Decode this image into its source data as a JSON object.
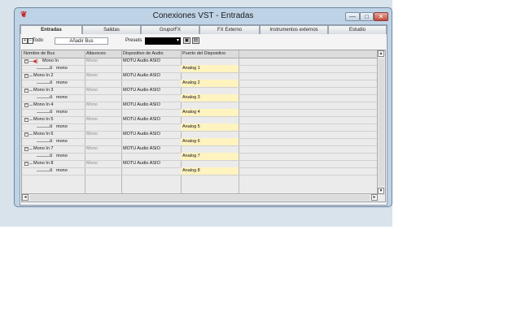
{
  "window": {
    "title": "Conexiones VST - Entradas",
    "buttons": {
      "minimize": "—",
      "maximize": "□",
      "close": "✕"
    }
  },
  "tabs": [
    {
      "label": "Entradas",
      "active": true
    },
    {
      "label": "Salidas",
      "active": false
    },
    {
      "label": "Grupo/FX",
      "active": false
    },
    {
      "label": "FX Externo",
      "active": false
    },
    {
      "label": "Instrumentos externos",
      "active": false
    },
    {
      "label": "Estudio",
      "active": false
    }
  ],
  "toolbar": {
    "todo_label": "Todo",
    "add_bus_label": "Añadir Bus",
    "presets_label": "Presets",
    "presets_value": "▾"
  },
  "grid": {
    "columns": [
      "Nombre de Bus",
      "Altavoces",
      "Dispositivo de Audio",
      "Puerto del Dispositivo"
    ],
    "buses": [
      {
        "name": "Mono In",
        "speakers": "Mono",
        "device": "MOTU Audio ASIO",
        "channel": "mono",
        "port": "Analog 1",
        "speaker_icon": true
      },
      {
        "name": "Mono In 2",
        "speakers": "Mono",
        "device": "MOTU Audio ASIO",
        "channel": "mono",
        "port": "Analog 2"
      },
      {
        "name": "Mono In 3",
        "speakers": "Mono",
        "device": "MOTU Audio ASIO",
        "channel": "mono",
        "port": "Analog 3"
      },
      {
        "name": "Mono In 4",
        "speakers": "Mono",
        "device": "MOTU Audio ASIO",
        "channel": "mono",
        "port": "Analog 4"
      },
      {
        "name": "Mono In 5",
        "speakers": "Mono",
        "device": "MOTU Audio ASIO",
        "channel": "mono",
        "port": "Analog 5"
      },
      {
        "name": "Mono In 6",
        "speakers": "Mono",
        "device": "MOTU Audio ASIO",
        "channel": "mono",
        "port": "Analog 6"
      },
      {
        "name": "Mono In 7",
        "speakers": "Mono",
        "device": "MOTU Audio ASIO",
        "channel": "mono",
        "port": "Analog 7"
      },
      {
        "name": "Mono In 8",
        "speakers": "Mono",
        "device": "MOTU Audio ASIO",
        "channel": "mono",
        "port": "Analog 8"
      }
    ]
  },
  "colors": {
    "port_highlight": "#fff3c0",
    "window_frame": "#bfd3e6",
    "speaker_icon": "#c6262a"
  }
}
